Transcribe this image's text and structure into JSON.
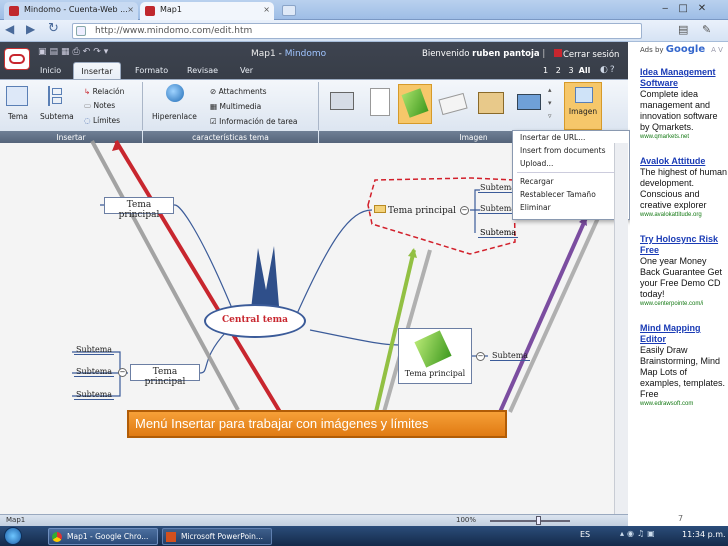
{
  "browser": {
    "tabs": [
      "Mindomo - Cuenta-Web ...",
      "Map1"
    ],
    "url": "http://www.mindomo.com/edit.htm"
  },
  "app": {
    "title": "Map1 - ",
    "brand": "Mindomo",
    "welcome": "Bienvenido",
    "user": "ruben pantoja",
    "logout": "Cerrar sesión",
    "pages": [
      "1",
      "2",
      "3",
      "All"
    ],
    "menu": [
      "Inicio",
      "Insertar",
      "Formato",
      "Revisae",
      "Ver"
    ],
    "ribbon": {
      "tema": "Tema",
      "subtema": "Subtema",
      "relacion": "Relación",
      "notes": "Notes",
      "limites": "Límites",
      "hiperenlace": "Hiperenlace",
      "attachments": "Attachments",
      "multimedia": "Multimedia",
      "info_tarea": "Información de tarea",
      "imagen": "Imagen"
    },
    "groups": [
      "Insertar",
      "características tema",
      "Imagen"
    ]
  },
  "context_menu": [
    "Insertar de URL...",
    "Insert from documents",
    "Upload...",
    "Recargar",
    "Restablecer Tamaño",
    "Eliminar"
  ],
  "map": {
    "central": "Central tema",
    "topics": [
      "Tema principal",
      "Tema principal",
      "Tema principal",
      "Tema principal"
    ],
    "subtema": "Subtema"
  },
  "caption": "Menú Insertar para trabajar con imágenes y límites",
  "ads": {
    "header": "Ads by ",
    "google": "Google",
    "nav": "A V",
    "items": [
      {
        "title": "Idea Management Software",
        "text": "Complete idea management and innovation software by Qmarkets.",
        "url": "www.qmarkets.net"
      },
      {
        "title": "Avalok Attitude",
        "text": "The highest of human development. Conscious and creative explorer",
        "url": "www.avalokattitude.org"
      },
      {
        "title": "Try Holosync Risk Free",
        "text": "One year Money Back Guarantee Get your Free Demo CD today!",
        "url": "www.centerpointe.com/i"
      },
      {
        "title": "Mind Mapping Editor",
        "text": "Easily Draw Brainstorming, Mind Map Lots of examples, templates. Free",
        "url": "www.edrawsoft.com"
      }
    ]
  },
  "status": {
    "left": "Map1",
    "zoom": "100%",
    "slide": "7"
  },
  "taskbar": {
    "items": [
      "Map1 - Google Chro...",
      "Microsoft PowerPoin..."
    ],
    "lang": "ES",
    "time": "11:34 p.m."
  },
  "colors": {
    "dark_app": "#2f343d",
    "line_red": "#c8262e",
    "line_green": "#8fbf3a",
    "line_purple": "#7b4da0",
    "line_gray": "#909090"
  }
}
